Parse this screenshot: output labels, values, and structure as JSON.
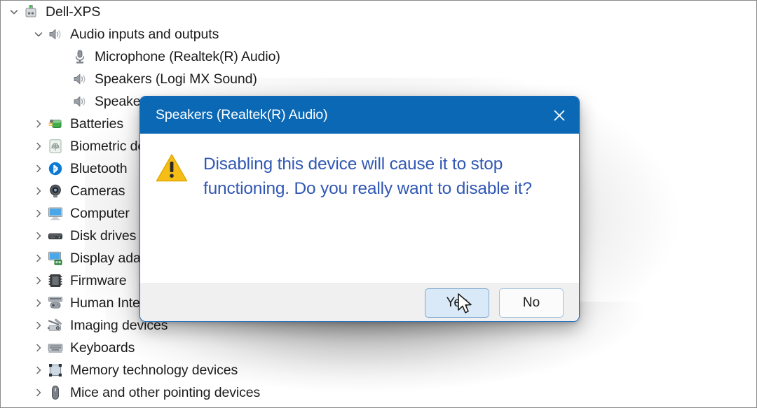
{
  "tree": {
    "items": [
      {
        "label": "Dell-XPS",
        "level": 0,
        "chevron": "expanded",
        "icon": "computer-tower-icon"
      },
      {
        "label": "Audio inputs and outputs",
        "level": 1,
        "chevron": "expanded",
        "icon": "speaker-icon"
      },
      {
        "label": "Microphone (Realtek(R) Audio)",
        "level": 2,
        "chevron": "none",
        "icon": "microphone-icon"
      },
      {
        "label": "Speakers (Logi MX Sound)",
        "level": 2,
        "chevron": "none",
        "icon": "speaker-icon"
      },
      {
        "label": "Speakers (Realtek(R) Audio)",
        "level": 2,
        "chevron": "none",
        "icon": "speaker-icon"
      },
      {
        "label": "Batteries",
        "level": 1,
        "chevron": "collapsed",
        "icon": "battery-icon"
      },
      {
        "label": "Biometric devices",
        "level": 1,
        "chevron": "collapsed",
        "icon": "fingerprint-icon"
      },
      {
        "label": "Bluetooth",
        "level": 1,
        "chevron": "collapsed",
        "icon": "bluetooth-icon"
      },
      {
        "label": "Cameras",
        "level": 1,
        "chevron": "collapsed",
        "icon": "camera-icon"
      },
      {
        "label": "Computer",
        "level": 1,
        "chevron": "collapsed",
        "icon": "monitor-icon"
      },
      {
        "label": "Disk drives",
        "level": 1,
        "chevron": "collapsed",
        "icon": "disk-drive-icon"
      },
      {
        "label": "Display adapters",
        "level": 1,
        "chevron": "collapsed",
        "icon": "display-adapter-icon"
      },
      {
        "label": "Firmware",
        "level": 1,
        "chevron": "collapsed",
        "icon": "firmware-chip-icon"
      },
      {
        "label": "Human Interface Devices",
        "level": 1,
        "chevron": "collapsed",
        "icon": "hid-gamepad-icon"
      },
      {
        "label": "Imaging devices",
        "level": 1,
        "chevron": "collapsed",
        "icon": "scanner-icon"
      },
      {
        "label": "Keyboards",
        "level": 1,
        "chevron": "collapsed",
        "icon": "keyboard-icon"
      },
      {
        "label": "Memory technology devices",
        "level": 1,
        "chevron": "collapsed",
        "icon": "memory-card-icon"
      },
      {
        "label": "Mice and other pointing devices",
        "level": 1,
        "chevron": "collapsed",
        "icon": "mouse-icon"
      }
    ]
  },
  "dialog": {
    "title": "Speakers (Realtek(R) Audio)",
    "close_label": "✕",
    "icon": "warning-triangle-icon",
    "message": "Disabling this device will cause it to stop functioning. Do you really want to disable it?",
    "buttons": [
      {
        "label": "Yes",
        "style": "default"
      },
      {
        "label": "No",
        "style": "secondary"
      }
    ]
  },
  "colors": {
    "title_bar": "#0A68B5",
    "dialog_border": "#1667ba",
    "message_text": "#3158b4",
    "warning_yellow": "#f5bd16",
    "default_button_bg": "#d9e9f7",
    "footer_bg": "#f0f0f0"
  }
}
